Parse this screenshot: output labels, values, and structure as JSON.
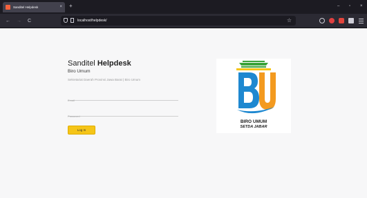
{
  "browser": {
    "tab_title": "Sanditel Helpdesk",
    "tab_close": "×",
    "new_tab": "+",
    "url": "localhost/helpdesk/",
    "window_controls": {
      "minimize": "–",
      "maximize": "▫",
      "close": "×"
    },
    "nav": {
      "back": "←",
      "forward": "→",
      "reload": "C"
    },
    "bookmark_star": "☆",
    "icons": [
      "back-arrow-icon",
      "forward-arrow-icon",
      "reload-icon",
      "shield-icon",
      "page-icon",
      "star-icon",
      "pocket-icon",
      "extension-icon",
      "extension-icon",
      "extension-icon",
      "menu-icon"
    ]
  },
  "login": {
    "brand_light": "Sanditel ",
    "brand_bold": "Helpdesk",
    "subtitle": "Biro Umum",
    "description": "Sekretariat Daerah Provinsi Jawa Barat | Biro Umum",
    "email_placeholder": "Email",
    "password_placeholder": "Password",
    "login_button": "Log In"
  },
  "logo": {
    "line1": "BIRO UMUM",
    "line2": "SETDA JABAR",
    "colors": {
      "green": "#3ba33b",
      "blue": "#1e88d0",
      "orange": "#f39a1f",
      "yellow": "#f5c518"
    }
  }
}
